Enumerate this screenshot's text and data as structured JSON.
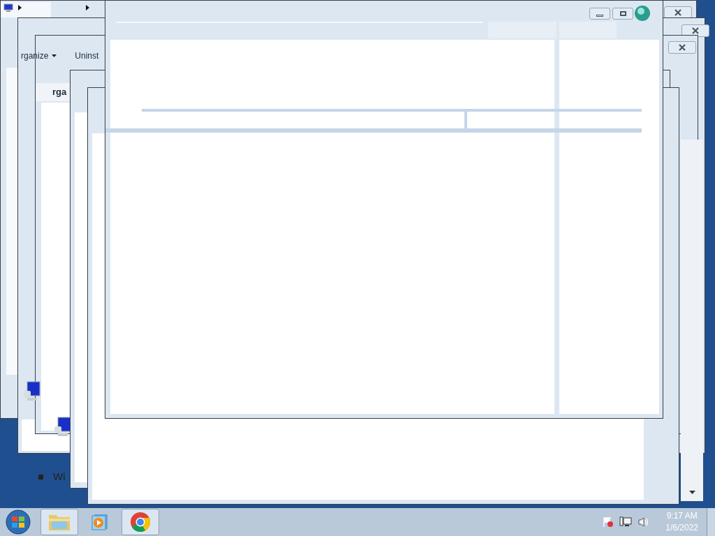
{
  "back_window": {
    "toolbar": [
      {
        "label": "rganize",
        "has_caret": true
      },
      {
        "label": "Uninst",
        "has_caret": false
      }
    ]
  },
  "middle_window": {
    "toolbar_label": "rga"
  },
  "lower_window": {
    "bullet_item": "Wi"
  },
  "taskbar": {
    "pinned": [
      {
        "kind": "explorer",
        "running": true
      },
      {
        "kind": "media",
        "running": false
      },
      {
        "kind": "chrome",
        "running": true
      }
    ],
    "clock": {
      "time": "9:17 AM",
      "date": "1/6/2022"
    }
  }
}
